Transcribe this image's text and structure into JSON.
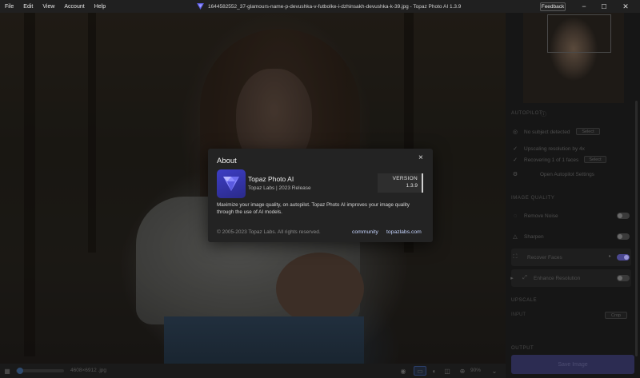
{
  "menu": {
    "items": [
      {
        "label": "File"
      },
      {
        "label": "Edit"
      },
      {
        "label": "View"
      },
      {
        "label": "Account"
      },
      {
        "label": "Help"
      }
    ]
  },
  "window": {
    "title": "1644582552_37-glamours-name-p-devushka-v-futbolke-i-dzhinsakh-devushka-k-39.jpg - Topaz Photo AI 1.3.9",
    "feedback_label": "Feedback",
    "minimize": "−",
    "maximize": "☐",
    "close": "✕"
  },
  "about": {
    "title": "About",
    "close": "×",
    "app_name": "Topaz Photo AI",
    "app_subtitle": "Topaz Labs | 2023 Release",
    "version_label": "VERSION",
    "version": "1.3.9",
    "description": "Maximize your image quality, on autopilot. Topaz Photo AI improves your image quality through the use of AI models.",
    "copyright": "© 2005-2023 Topaz Labs. All rights reserved.",
    "link_community": "community",
    "link_website": "topazlabs.com"
  },
  "sidebar": {
    "autopilot_label": "AUTOPILOT",
    "subject_row": "No subject detected",
    "subject_button": "Select",
    "upscale_row": "Upscaling resolution by 4x",
    "faces_row": "Recovering 1 of 1 faces",
    "faces_button": "Select",
    "autopilot_settings": "Open Autopilot Settings",
    "image_quality_label": "IMAGE QUALITY",
    "filters": [
      {
        "label": "Remove Noise",
        "enabled": false
      },
      {
        "label": "Sharpen",
        "enabled": false
      },
      {
        "label": "Recover Faces",
        "enabled": true
      },
      {
        "label": "Enhance Resolution",
        "enabled": false
      }
    ],
    "upscale_label": "UPSCALE",
    "upscale_input_label": "INPUT",
    "upscale_crop": "Crop",
    "output_label": "OUTPUT",
    "save_label": "Save Image"
  },
  "statusbar": {
    "file_label": "4608×6912 .jpg",
    "zoom": "90%",
    "progress": 0.05
  },
  "colors": {
    "accent": "#3b3bbf",
    "link": "#c6d5ff"
  }
}
